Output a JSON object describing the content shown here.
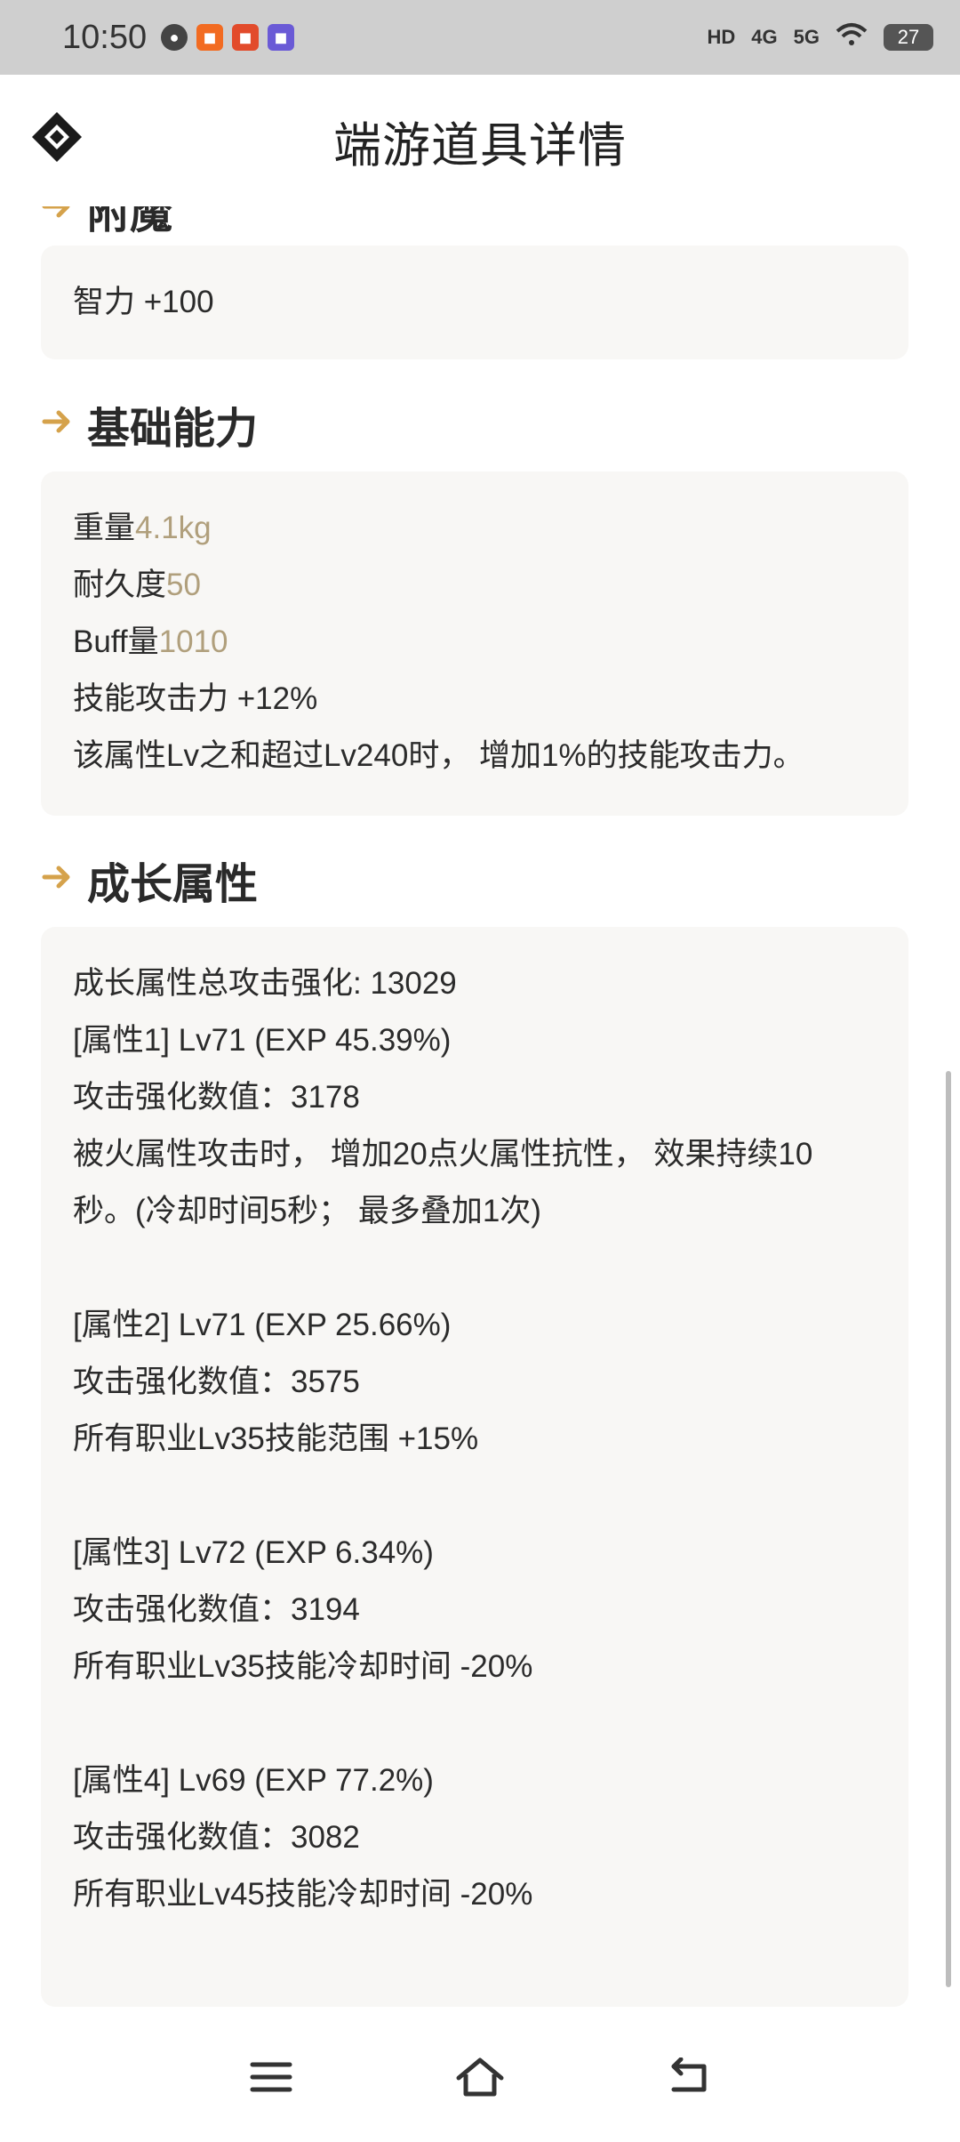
{
  "status": {
    "time": "10:50",
    "indicators": [
      "HD",
      "4G",
      "5G"
    ],
    "battery": "27",
    "colors": {
      "bar": "#cfcfcf"
    },
    "app_icons": [
      "chat-bubble-icon",
      "orange-app-icon",
      "red-app-icon",
      "purple-app-icon"
    ]
  },
  "header": {
    "title": "端游道具详情"
  },
  "sections": {
    "enchant": {
      "title": "附魔",
      "lines": [
        "智力 +100"
      ]
    },
    "basic": {
      "title": "基础能力",
      "lines": [
        {
          "label": "重量",
          "value": "4.1kg"
        },
        {
          "label": "耐久度",
          "value": "50"
        },
        {
          "label": "Buff量",
          "value": "1010"
        },
        {
          "label": "技能攻击力 +12%",
          "value": ""
        },
        {
          "label": "该属性Lv之和超过Lv240时， 增加1%的技能攻击力。",
          "value": ""
        }
      ]
    },
    "growth": {
      "title": "成长属性",
      "lines": [
        "成长属性总攻击强化: 13029",
        "[属性1] Lv71 (EXP 45.39%)",
        "攻击强化数值：3178",
        "被火属性攻击时， 增加20点火属性抗性， 效果持续10",
        "秒。(冷却时间5秒； 最多叠加1次)",
        "",
        "[属性2] Lv71 (EXP 25.66%)",
        "攻击强化数值：3575",
        "所有职业Lv35技能范围 +15%",
        "",
        "[属性3] Lv72 (EXP 6.34%)",
        "攻击强化数值：3194",
        "所有职业Lv35技能冷却时间 -20%",
        "",
        "[属性4] Lv69 (EXP 77.2%)",
        "攻击强化数值：3082",
        "所有职业Lv45技能冷却时间 -20%"
      ]
    }
  },
  "colors": {
    "accent": "#d5a24b",
    "muted_value": "#b09f7c",
    "card_bg": "#f8f7f5"
  }
}
